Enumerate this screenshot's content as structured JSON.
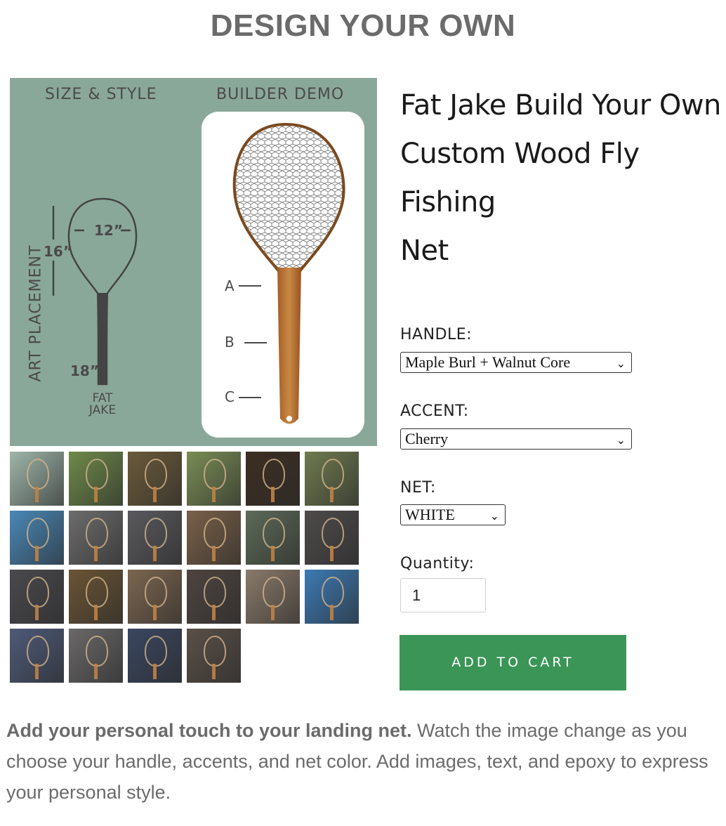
{
  "page": {
    "title": "DESIGN YOUR OWN"
  },
  "hero": {
    "left_label": "SIZE & STYLE",
    "right_label": "BUILDER DEMO",
    "dim_width": "12”",
    "dim_height": "16”",
    "dim_handle": "18”",
    "model_name_1": "FAT",
    "model_name_2": "JAKE",
    "art_placement_label": "ART PLACEMENT",
    "placements": [
      "A",
      "B",
      "C"
    ]
  },
  "thumbnails": [
    {
      "name": "size-style-thumb",
      "color": "#9fb6aa"
    },
    {
      "name": "grass-net-thumb",
      "color": "#6f8a4a"
    },
    {
      "name": "trout-thumb",
      "color": "#6b5a3a"
    },
    {
      "name": "purple-net-thumb",
      "color": "#7a8d55"
    },
    {
      "name": "dark-net-thumb",
      "color": "#3c2e22"
    },
    {
      "name": "angler-thumb",
      "color": "#6f7a4f"
    },
    {
      "name": "workshop-thumb",
      "color": "#4a88b8"
    },
    {
      "name": "brick-net-thumb-1",
      "color": "#6c6c6c"
    },
    {
      "name": "brick-net-thumb-2",
      "color": "#5a5a5e"
    },
    {
      "name": "net-detail-thumb",
      "color": "#7a6048"
    },
    {
      "name": "three-nets-thumb",
      "color": "#5d6a58"
    },
    {
      "name": "brick-net-thumb-3",
      "color": "#4e4a4a"
    },
    {
      "name": "dark-handle-thumb",
      "color": "#4a4a4e"
    },
    {
      "name": "hand-net-thumb",
      "color": "#6a5434"
    },
    {
      "name": "burl-handle-thumb",
      "color": "#7c6650"
    },
    {
      "name": "glass-detail-thumb",
      "color": "#4e4440"
    },
    {
      "name": "frame-detail-thumb",
      "color": "#8a7a6a"
    },
    {
      "name": "lake-thumb",
      "color": "#3c7ab4"
    },
    {
      "name": "wood-stand-thumb",
      "color": "#4e5a78"
    },
    {
      "name": "brick-net-thumb-4",
      "color": "#6a6868"
    },
    {
      "name": "blue-wall-thumb",
      "color": "#3a4660"
    },
    {
      "name": "wood-net-thumb",
      "color": "#5a5048"
    }
  ],
  "product": {
    "title_line_1": "Fat Jake Build Your Own",
    "title_line_2": "Custom Wood Fly Fishing",
    "title_line_3": "Net",
    "handle_label": "HANDLE:",
    "handle_value": "Maple Burl + Walnut Core",
    "accent_label": "ACCENT:",
    "accent_value": "Cherry",
    "net_label": "NET:",
    "net_value": "WHITE",
    "quantity_label": "Quantity:",
    "quantity_value": "1",
    "add_to_cart": "ADD TO CART",
    "button_color": "#3a9557"
  },
  "description": {
    "bold": "Add your personal touch to your landing net.",
    "text": " Watch the image change as you choose your handle, accents, and net color. Add images, text, and epoxy to express your personal style."
  }
}
